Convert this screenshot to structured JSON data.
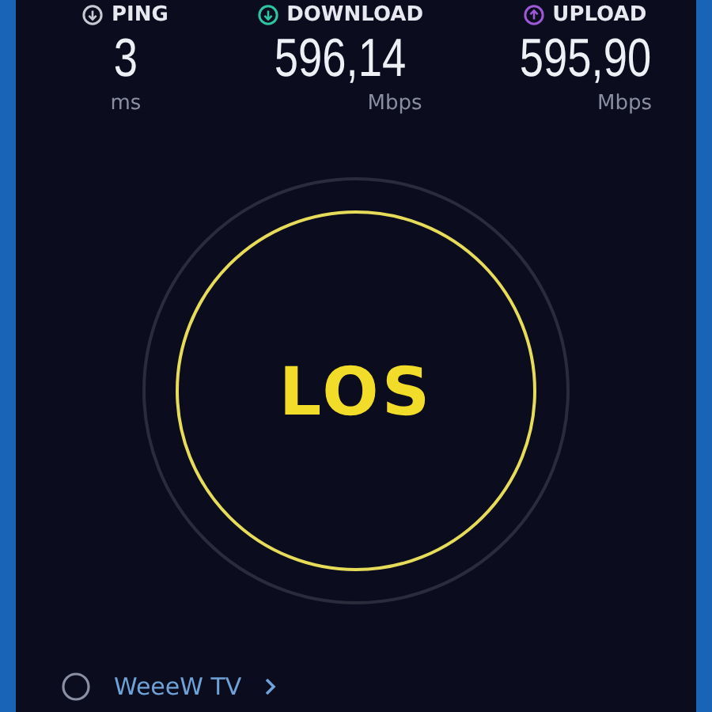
{
  "metrics": [
    {
      "kind": "ping",
      "label": "PING",
      "value": "3",
      "unit": "ms"
    },
    {
      "kind": "download",
      "label": "DOWNLOAD",
      "value": "596,14",
      "unit": "Mbps"
    },
    {
      "kind": "upload",
      "label": "UPLOAD",
      "value": "595,90",
      "unit": "Mbps"
    }
  ],
  "go_button": {
    "label": "LOS"
  },
  "provider": {
    "name": "WeeeW TV"
  }
}
